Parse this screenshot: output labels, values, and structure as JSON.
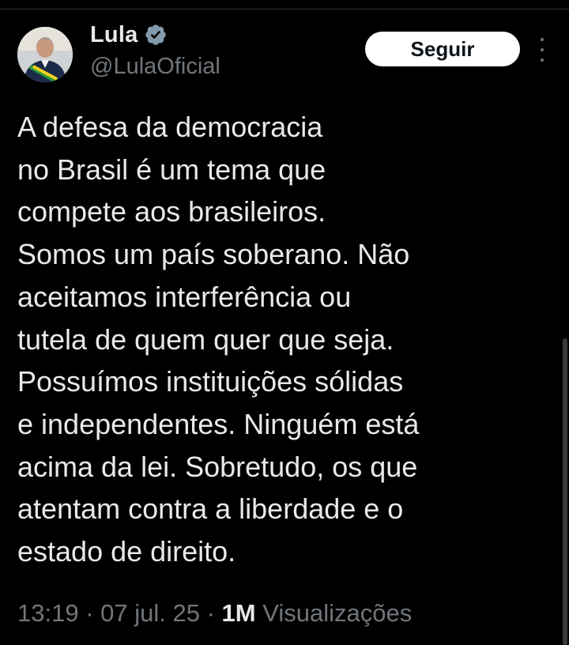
{
  "author": {
    "display_name": "Lula",
    "handle": "@LulaOficial",
    "verified_icon": "verified-badge-icon",
    "avatar_icon": "profile-photo"
  },
  "follow_button": {
    "label": "Seguir"
  },
  "more_menu": {
    "icon": "more-options-icon"
  },
  "tweet": {
    "text": "A defesa da democracia\nno Brasil é um tema que\ncompete aos brasileiros.\nSomos um país soberano. Não\naceitamos interferência ou\ntutela de quem quer que seja.\nPossuímos instituições sólidas\ne independentes. Ninguém está\nacima da lei. Sobretudo, os que\natentam contra a liberdade e o\nestado de direito."
  },
  "meta": {
    "time": "13:19",
    "separator": " · ",
    "date": "07 jul. 25",
    "views_count": "1M",
    "views_label": " Visualizações"
  },
  "colors": {
    "background": "#000000",
    "text_primary": "#e7e9ea",
    "text_secondary": "#71767b",
    "follow_bg": "#ffffff",
    "verified": "#829aab"
  }
}
